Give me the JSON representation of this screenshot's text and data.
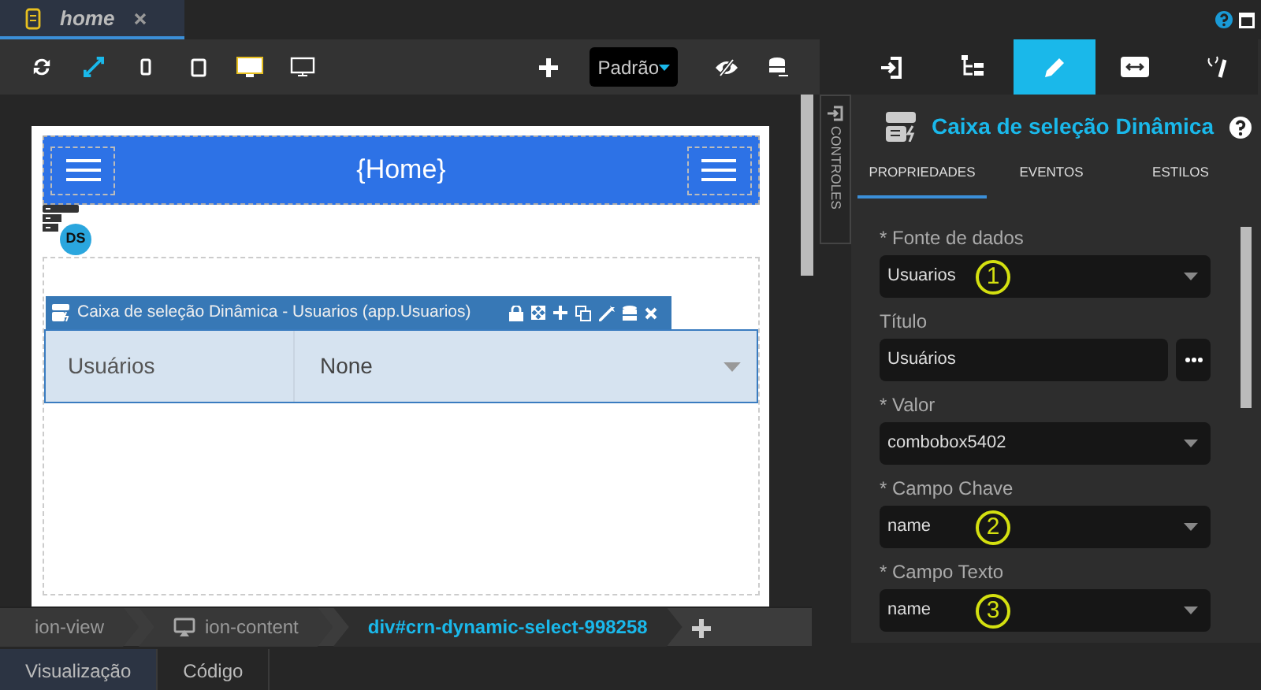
{
  "tab": {
    "title": "home"
  },
  "toolbar": {
    "theme": "Padrão"
  },
  "phone": {
    "header_title": "{Home}",
    "badge": "DS",
    "component_bar": "Caixa de seleção Dinâmica - Usuarios (app.Usuarios)",
    "select": {
      "label": "Usuários",
      "value": "None"
    }
  },
  "side_tab": "CONTROLES",
  "panel": {
    "tabs": [
      {
        "kind": "import",
        "selected": false
      },
      {
        "kind": "tree",
        "selected": false
      },
      {
        "kind": "pencil",
        "selected": true
      },
      {
        "kind": "resize",
        "selected": false
      },
      {
        "kind": "magic",
        "selected": false
      }
    ],
    "title": "Caixa de seleção Dinâmica",
    "subtabs": [
      {
        "label": "PROPRIEDADES",
        "selected": true
      },
      {
        "label": "EVENTOS",
        "selected": false
      },
      {
        "label": "ESTILOS",
        "selected": false
      }
    ],
    "fields": [
      {
        "kind": "select",
        "label": "* Fonte de dados",
        "value": "Usuarios",
        "callout": "1"
      },
      {
        "kind": "text",
        "label": "Título",
        "value": "Usuários"
      },
      {
        "kind": "select",
        "label": "* Valor",
        "value": "combobox5402"
      },
      {
        "kind": "select",
        "label": "* Campo Chave",
        "value": "name",
        "callout": "2"
      },
      {
        "kind": "select",
        "label": "* Campo Texto",
        "value": "name",
        "callout": "3"
      }
    ]
  },
  "breadcrumbs": [
    {
      "label": "ion-view",
      "selected": false
    },
    {
      "label": "ion-content",
      "selected": false
    },
    {
      "label": "div#crn-dynamic-select-998258",
      "selected": true
    }
  ],
  "bottom_tabs": [
    {
      "label": "Visualização",
      "selected": true
    },
    {
      "label": "Código",
      "selected": false
    }
  ]
}
